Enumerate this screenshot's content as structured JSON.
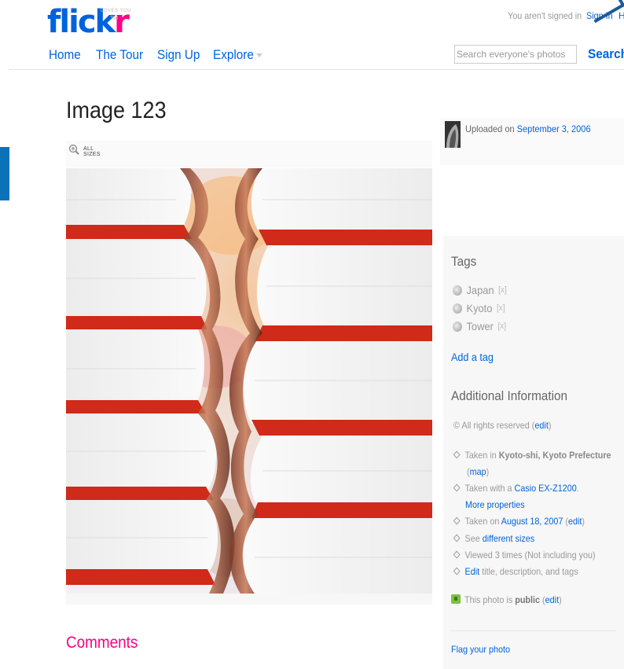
{
  "header": {
    "logo_main": "flick",
    "logo_accent": "r",
    "logo_tagline": "LOVES YOU",
    "logo_tm": "TM",
    "signed_out_text": "You aren't signed in",
    "sign_in": "Sign In",
    "help_partial": "H",
    "nav": [
      "Home",
      "The Tour",
      "Sign Up",
      "Explore"
    ],
    "search_placeholder": "Search everyone's photos",
    "search_button": "Search"
  },
  "photo": {
    "title": "Image 123",
    "all_sizes_line1": "ALL",
    "all_sizes_line2": "SIZES"
  },
  "sidebar": {
    "uploaded_prefix": "Uploaded on ",
    "uploaded_date": "September 3, 2006",
    "tags_heading": "Tags",
    "tags": [
      "Japan",
      "Kyoto",
      "Tower"
    ],
    "tag_remove": "[x]",
    "add_tag": "Add a tag",
    "additional_heading": "Additional Information",
    "rights_text": "© All rights reserved",
    "edit": "edit",
    "taken_in_prefix": "Taken in ",
    "taken_in_place": "Kyoto-shi, Kyoto Prefecture",
    "map": "map",
    "taken_with_prefix": "Taken with a ",
    "camera": "Casio EX-Z1200",
    "more_properties": "More properties",
    "taken_on_prefix": "Taken on ",
    "taken_on_date": "August 18, 2007",
    "see_prefix": "See ",
    "different_sizes": "different sizes",
    "viewed": "Viewed 3 times  (Not including you)",
    "edit_link": "Edit",
    "edit_rest": " title, description, and tags",
    "public_prefix": "This photo is ",
    "public_word": "public",
    "flag": "Flag your photo"
  },
  "comments_heading": "Comments",
  "colors": {
    "brand_blue": "#0063dc",
    "brand_pink": "#ff0084"
  }
}
